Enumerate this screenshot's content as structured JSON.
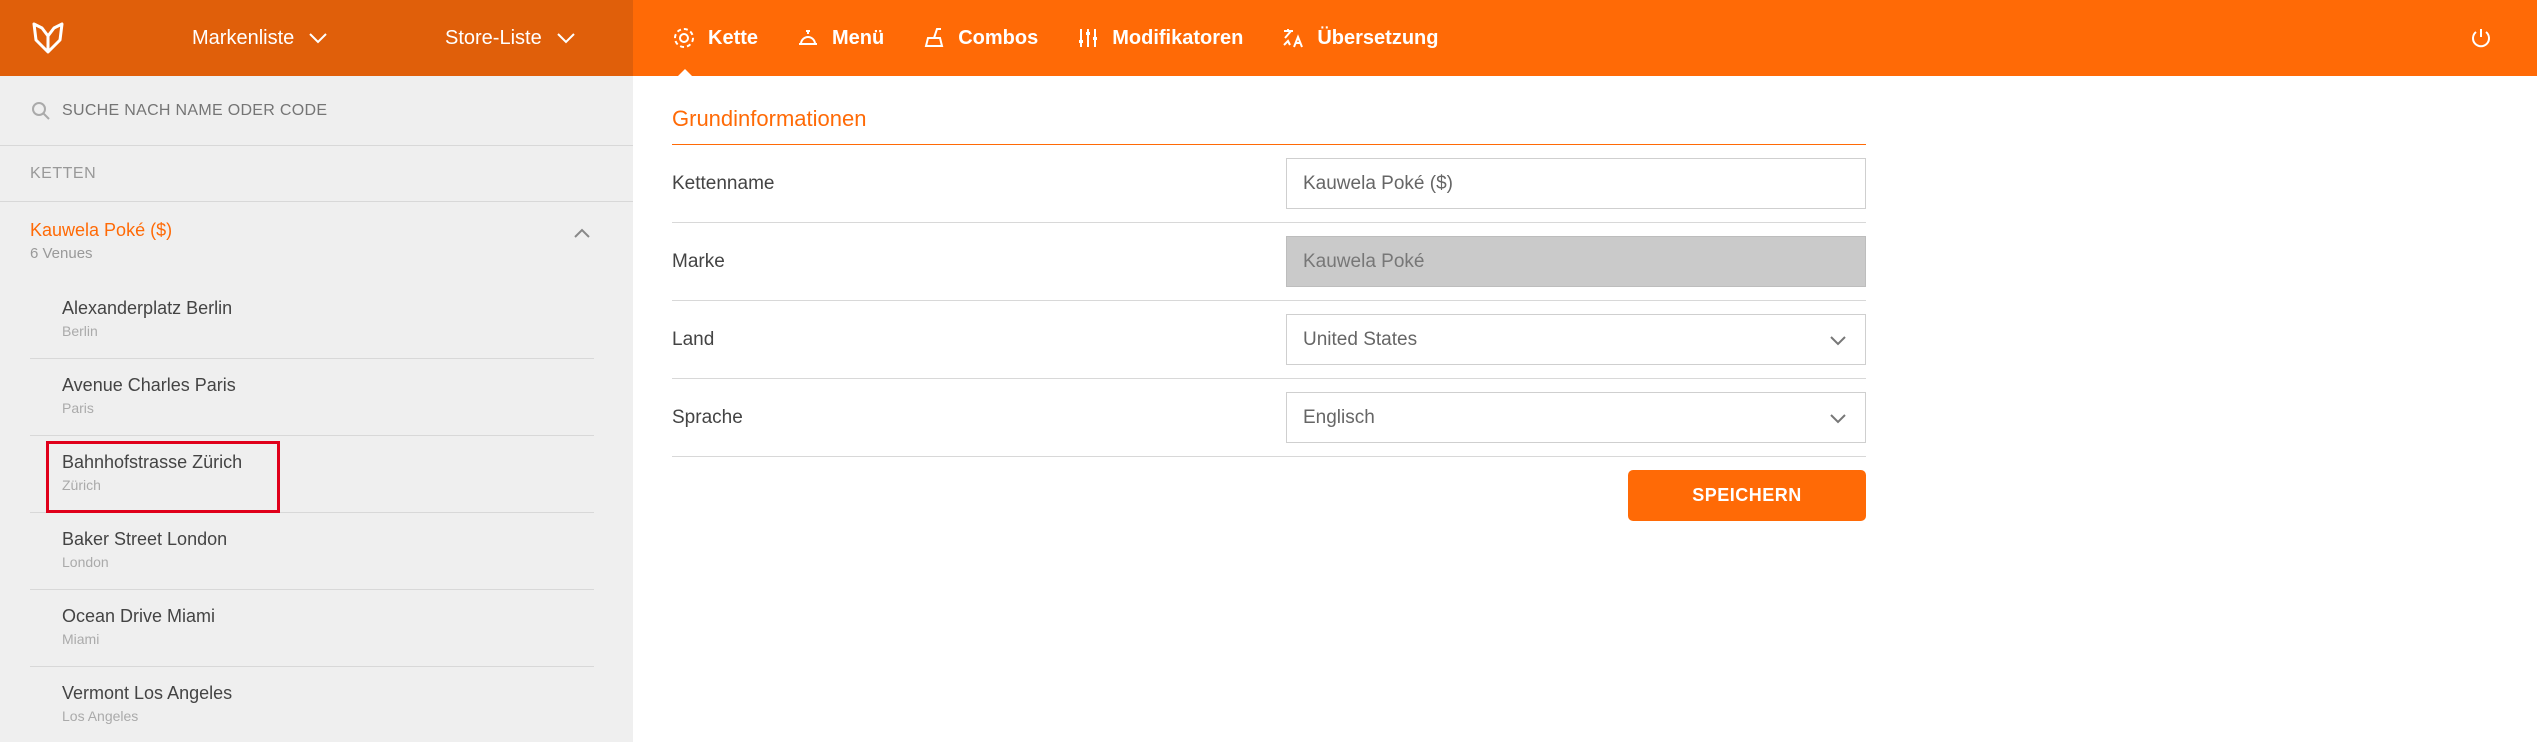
{
  "header": {
    "brand_list": "Markenliste",
    "store_list": "Store-Liste",
    "nav": [
      {
        "label": "Kette",
        "icon": "gear-icon"
      },
      {
        "label": "Menü",
        "icon": "cloche-icon"
      },
      {
        "label": "Combos",
        "icon": "drink-icon"
      },
      {
        "label": "Modifikatoren",
        "icon": "sliders-icon"
      },
      {
        "label": "Übersetzung",
        "icon": "translate-icon"
      }
    ],
    "accent_color": "#ff6a06",
    "left_color": "#e05f0a"
  },
  "sidebar": {
    "search_placeholder": "SUCHE NACH NAME ODER CODE",
    "section_label": "KETTEN",
    "chain": {
      "name": "Kauwela Poké ($)",
      "venue_count": "6 Venues"
    },
    "venues": [
      {
        "name": "Alexanderplatz Berlin",
        "city": "Berlin"
      },
      {
        "name": "Avenue Charles Paris",
        "city": "Paris"
      },
      {
        "name": "Bahnhofstrasse Zürich",
        "city": "Zürich"
      },
      {
        "name": "Baker Street London",
        "city": "London"
      },
      {
        "name": "Ocean Drive Miami",
        "city": "Miami"
      },
      {
        "name": "Vermont Los Angeles",
        "city": "Los Angeles"
      }
    ]
  },
  "main": {
    "section_title": "Grundinformationen",
    "fields": {
      "chain_name": {
        "label": "Kettenname",
        "value": "Kauwela Poké ($)"
      },
      "brand": {
        "label": "Marke",
        "value": "Kauwela Poké"
      },
      "country": {
        "label": "Land",
        "value": "United States"
      },
      "language": {
        "label": "Sprache",
        "value": "Englisch"
      }
    },
    "save_label": "SPEICHERN"
  }
}
